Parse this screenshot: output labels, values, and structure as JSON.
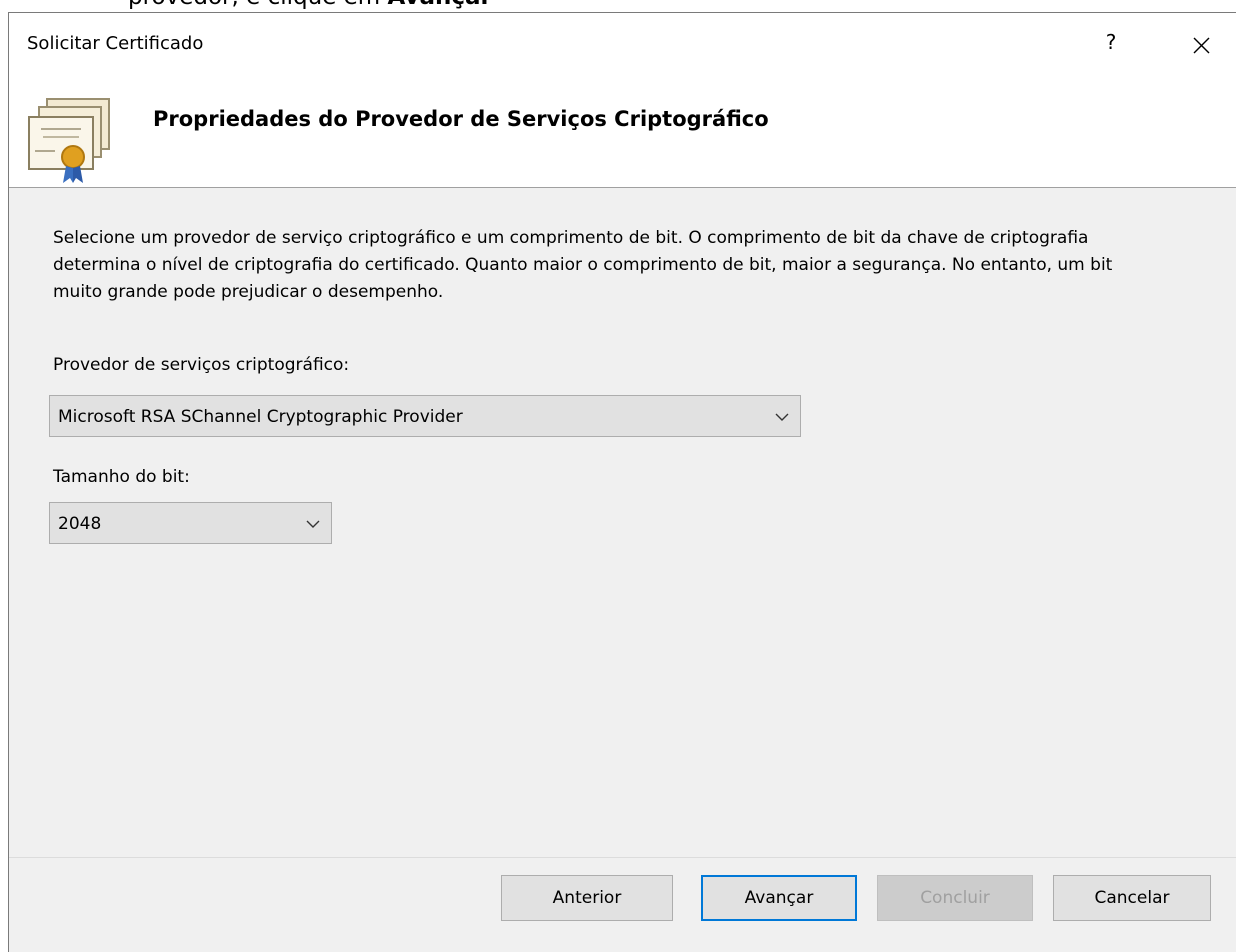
{
  "background_text": {
    "prefix": "provedor, e clique em ",
    "bold": "Avançar"
  },
  "window": {
    "title": "Solicitar Certificado",
    "help_label": "?",
    "close_icon": "close-icon"
  },
  "header": {
    "icon": "certificate-icon",
    "title": "Propriedades do Provedor de Serviços Criptográfico"
  },
  "main": {
    "description": "Selecione um provedor de serviço criptográfico e um comprimento de bit. O comprimento de bit da chave de criptografia determina o nível de criptografia do certificado. Quanto maior o comprimento de bit, maior a segurança. No entanto, um bit muito grande pode prejudicar o desempenho.",
    "provider_label": "Provedor de serviços criptográfico:",
    "provider_value": "Microsoft RSA SChannel Cryptographic Provider",
    "bit_label": "Tamanho do bit:",
    "bit_value": "2048"
  },
  "buttons": {
    "back": "Anterior",
    "next": "Avançar",
    "finish": "Concluir",
    "cancel": "Cancelar"
  },
  "colors": {
    "accent": "#0078d7",
    "dialog_bg": "#f0f0f0"
  }
}
